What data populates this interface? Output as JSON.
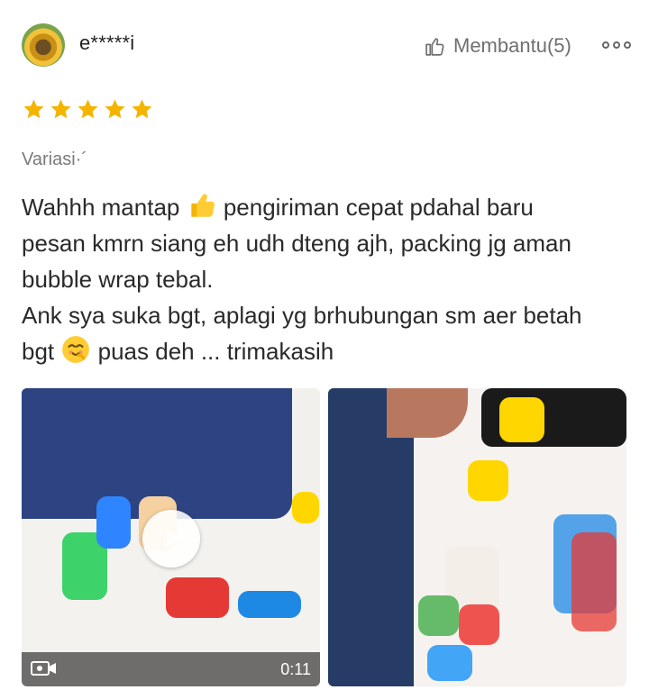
{
  "review": {
    "username": "e*****i",
    "helpful_label": "Membantu(5)",
    "rating": 5,
    "variation_label": "Variasi·´",
    "text_lines": [
      "Wahhh mantap",
      "pengiriman cepat pdahal baru",
      "pesan kmrn siang eh udh dteng ajh, packing jg aman",
      "bubble wrap tebal.",
      "Ank sya suka bgt, aplagi yg brhubungan sm aer betah",
      "bgt",
      "puas deh ... trimakasih"
    ]
  },
  "media": {
    "video_duration": "0:11"
  },
  "colors": {
    "star": "#f5b400",
    "text": "#2a2a2a",
    "muted": "#7a7a7a",
    "accent": "#ee4d2d"
  },
  "icons": {
    "avatar": "avatar-icon",
    "helpful": "thumbs-up-icon",
    "more": "more-options-icon",
    "rating": "star-icon",
    "emoji_thumbs": "thumbs-up-emoji-icon",
    "emoji_shy": "shy-face-emoji-icon",
    "play": "play-icon",
    "video": "video-icon"
  }
}
